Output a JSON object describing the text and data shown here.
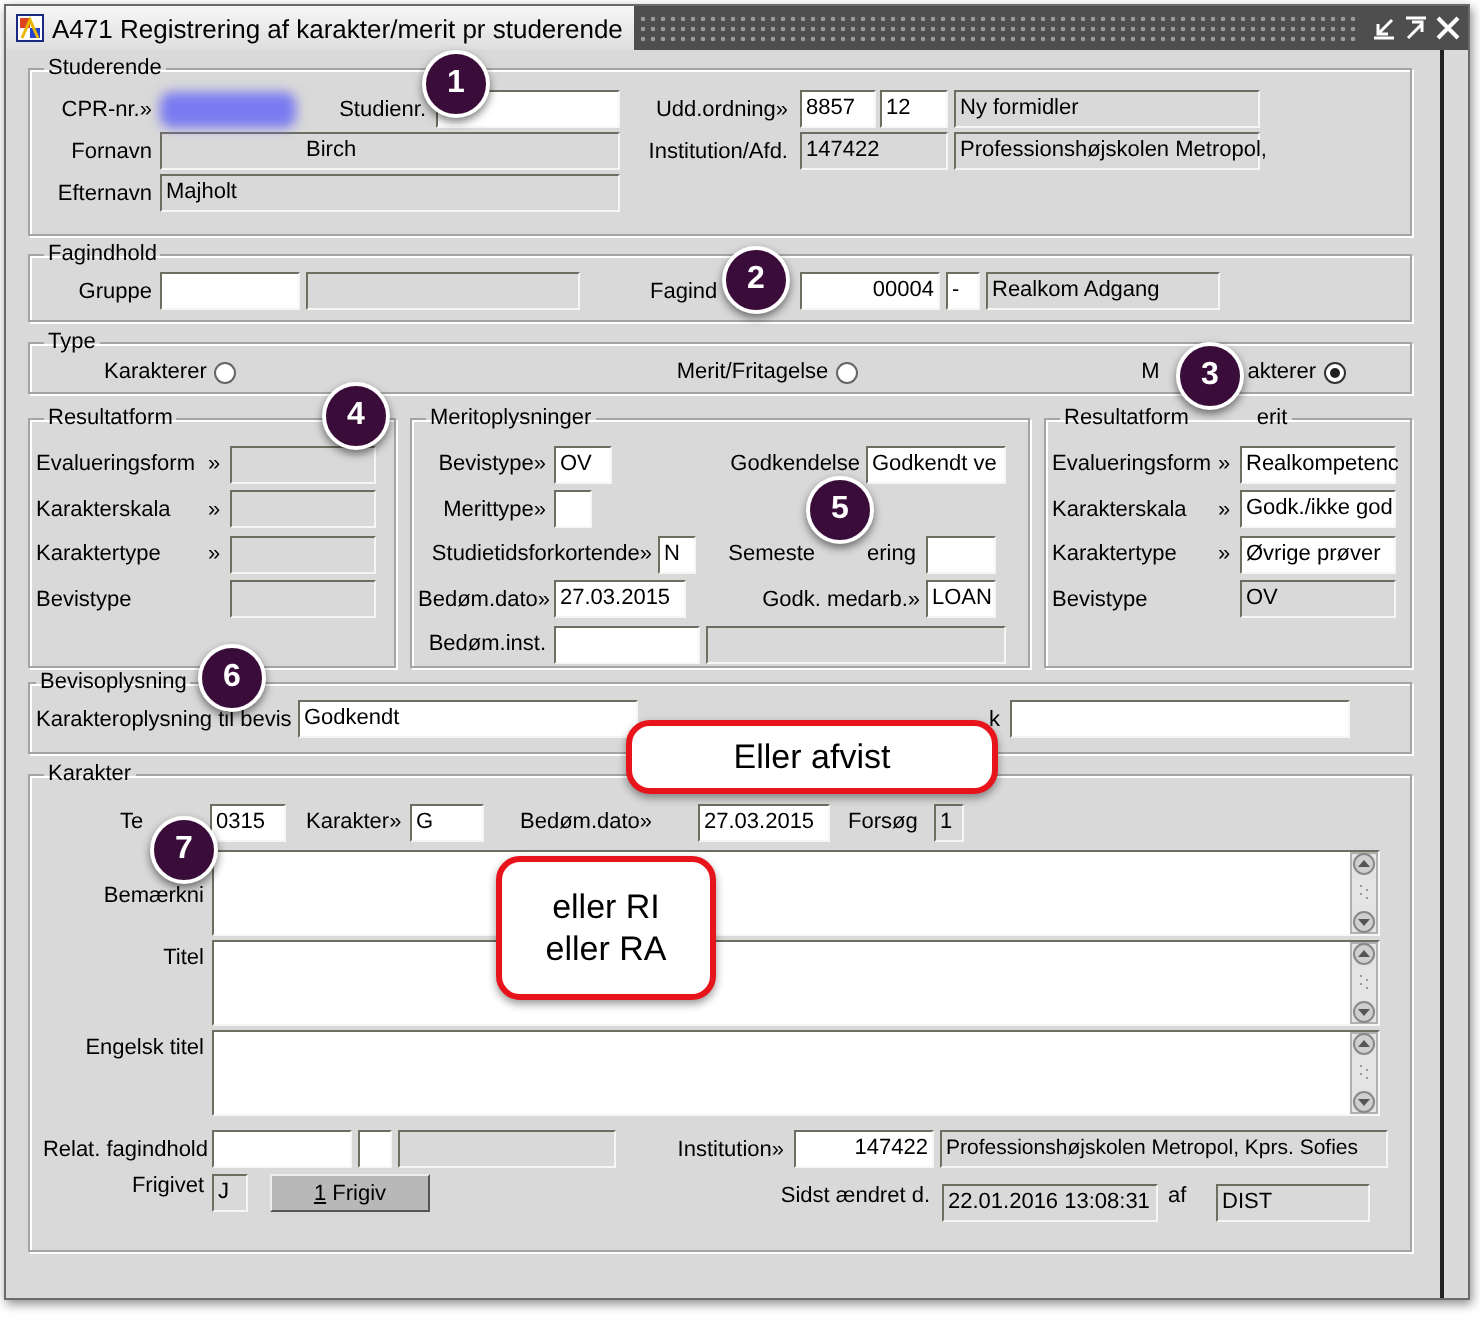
{
  "window": {
    "title": "A471 Registrering af karakter/merit pr studerende"
  },
  "studerende": {
    "title": "Studerende",
    "cpr_label": "CPR-nr.»",
    "studienr_label": "Studienr.",
    "studienr": {
      "disabled": false
    },
    "fornavn_label": "Fornavn",
    "fornavn": {
      "value": "Birch",
      "disabled": true
    },
    "efternavn_label": "Efternavn",
    "efternavn": {
      "value": "Majholt",
      "disabled": true
    },
    "udd_label": "Udd.ordning»",
    "udd_code": {
      "value": "8857",
      "disabled": false
    },
    "udd_version": {
      "value": "12",
      "disabled": false
    },
    "udd_name": {
      "value": "Ny formidler",
      "disabled": true
    },
    "inst_label": "Institution/Afd.",
    "inst_code": {
      "value": "147422",
      "disabled": true
    },
    "inst_name": {
      "value": "Professionshøjskolen Metropol,",
      "disabled": true
    }
  },
  "fagindhold": {
    "title": "Fagindhold",
    "gruppe_label": "Gruppe",
    "gruppe_code": {
      "disabled": false
    },
    "gruppe_name": {
      "disabled": true
    },
    "fag_label": "Fagind",
    "fag_code": {
      "value": "00004",
      "disabled": false
    },
    "fag_sep": {
      "value": "-",
      "disabled": false
    },
    "fag_name": {
      "value": "Realkom Adgang",
      "disabled": true
    }
  },
  "type": {
    "title": "Type",
    "options": [
      {
        "label_parts": [
          "Karakterer"
        ],
        "selected": false
      },
      {
        "label_parts": [
          "Merit/Fritagelse"
        ],
        "selected": false
      },
      {
        "label_parts": [
          "M",
          "akterer"
        ],
        "selected": true
      }
    ]
  },
  "resultatform": {
    "title": "Resultatform",
    "rows": [
      {
        "label": "Evalueringsform",
        "lookup": "»",
        "field": {
          "disabled": true
        }
      },
      {
        "label": "Karakterskala",
        "lookup": "»",
        "field": {
          "disabled": true
        }
      },
      {
        "label": "Karaktertype",
        "lookup": "»",
        "field": {
          "disabled": true
        }
      },
      {
        "label": "Bevistype",
        "field": {
          "disabled": true
        }
      }
    ]
  },
  "meritoplysninger": {
    "title": "Meritoplysninger",
    "bevistype_label": "Bevistype»",
    "bevistype": {
      "value": "OV",
      "disabled": false
    },
    "godkendelse_label": "Godkendelse",
    "godkendelse": {
      "value": "Godkendt ve",
      "disabled": false
    },
    "merittype_label": "Merittype»",
    "merittype": {
      "disabled": false
    },
    "studietid_label": "Studietidsforkortende»",
    "studietid": {
      "value": "N",
      "disabled": false
    },
    "semester_label_parts": [
      "Semeste",
      "ering"
    ],
    "semester": {
      "disabled": false
    },
    "dato_label": "Bedøm.dato»",
    "dato": {
      "value": "27.03.2015",
      "disabled": false
    },
    "medarb_label": "Godk. medarb.»",
    "medarb": {
      "value": "LOAN",
      "disabled": false
    },
    "inst_label": "Bedøm.inst.",
    "inst_code": {
      "disabled": false
    },
    "inst_name": {
      "disabled": true
    }
  },
  "resultatform_merit": {
    "title_parts": [
      "Resultatform",
      "erit"
    ],
    "rows": [
      {
        "label": "Evalueringsform",
        "lookup": "»",
        "field": {
          "value": "Realkompetenc",
          "disabled": false
        }
      },
      {
        "label": "Karakterskala",
        "lookup": "»",
        "field": {
          "value": "Godk./ikke god",
          "disabled": false
        }
      },
      {
        "label": "Karaktertype",
        "lookup": "»",
        "field": {
          "value": "Øvrige prøver",
          "disabled": false
        }
      },
      {
        "label": "Bevistype",
        "field": {
          "value": "OV",
          "disabled": true
        }
      }
    ]
  },
  "bevisoplysning": {
    "title": "Bevisoplysning",
    "label": "Karakteroplysning til bevis",
    "field": {
      "value": "Godkendt",
      "disabled": false
    },
    "label_2": "k",
    "field_2": {
      "disabled": false
    }
  },
  "karakter": {
    "title": "Karakter",
    "tekst_label": "Te",
    "tekst": {
      "value": "0315",
      "disabled": false
    },
    "karakter_label": "Karakter»",
    "karakter": {
      "value": "G",
      "disabled": false
    },
    "dato_label": "Bedøm.dato»",
    "dato": {
      "value": "27.03.2015",
      "disabled": false
    },
    "forsoeg_label": "Forsøg",
    "forsoeg": {
      "value": "1",
      "disabled": true
    },
    "textareas": [
      {
        "label": "Bemærkni",
        "disabled": false
      },
      {
        "label": "Titel",
        "disabled": false
      },
      {
        "label": "Engelsk titel",
        "disabled": false
      }
    ],
    "relat_label": "Relat. fagindhold",
    "relat_code": {
      "disabled": false
    },
    "relat_sep": {
      "disabled": false
    },
    "relat_name": {
      "disabled": true
    },
    "inst_label": "Institution»",
    "inst_code": {
      "value": "147422",
      "disabled": false
    },
    "inst_name": {
      "value": "Professionshøjskolen Metropol, Kprs. Sofies",
      "disabled": true
    },
    "frigivet_label": "Frigivet",
    "frigivet": {
      "value": "J",
      "disabled": true
    },
    "frigiv_button": "1 Frigiv",
    "sidst_label": "Sidst ændret d.",
    "sidst": {
      "value": "22.01.2016 13:08:31",
      "disabled": true
    },
    "af_label": "af",
    "af": {
      "value": "DIST",
      "disabled": true
    }
  },
  "callouts": [
    "1",
    "2",
    "3",
    "4",
    "5",
    "6",
    "7"
  ],
  "notes": [
    {
      "text": "Eller afvist"
    },
    {
      "text": "eller RI\neller RA"
    }
  ]
}
